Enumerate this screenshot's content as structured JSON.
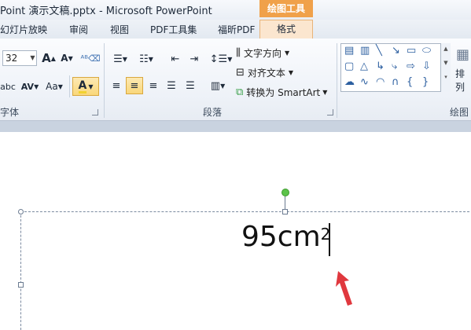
{
  "window": {
    "title": "Point 演示文稿.pptx  -  Microsoft PowerPoint",
    "context_tab_group": "绘图工具"
  },
  "tabs": [
    {
      "label": "幻灯片放映"
    },
    {
      "label": "审阅"
    },
    {
      "label": "视图"
    },
    {
      "label": "PDF工具集"
    },
    {
      "label": "福昕PDF"
    },
    {
      "label": "格式",
      "active": true
    }
  ],
  "ribbon": {
    "font": {
      "size_value": "32",
      "group_label": "字体",
      "grow_font": "A",
      "shrink_font": "A",
      "spacing_label": "AV",
      "case_label": "Aa",
      "font_color_label": "A",
      "font_color": "#f2d230"
    },
    "paragraph": {
      "group_label": "段落",
      "text_direction": "文字方向",
      "align_text": "对齐文本",
      "convert_smartart": "转换为 SmartArt"
    },
    "drawing": {
      "group_label": "绘图",
      "arrange_label": "排列"
    }
  },
  "slide": {
    "text_main": "95cm",
    "text_sup": "2"
  },
  "colors": {
    "accent_tab": "#f0a14a",
    "rotate_handle": "#5cc34a",
    "arrow": "#e0383e"
  }
}
